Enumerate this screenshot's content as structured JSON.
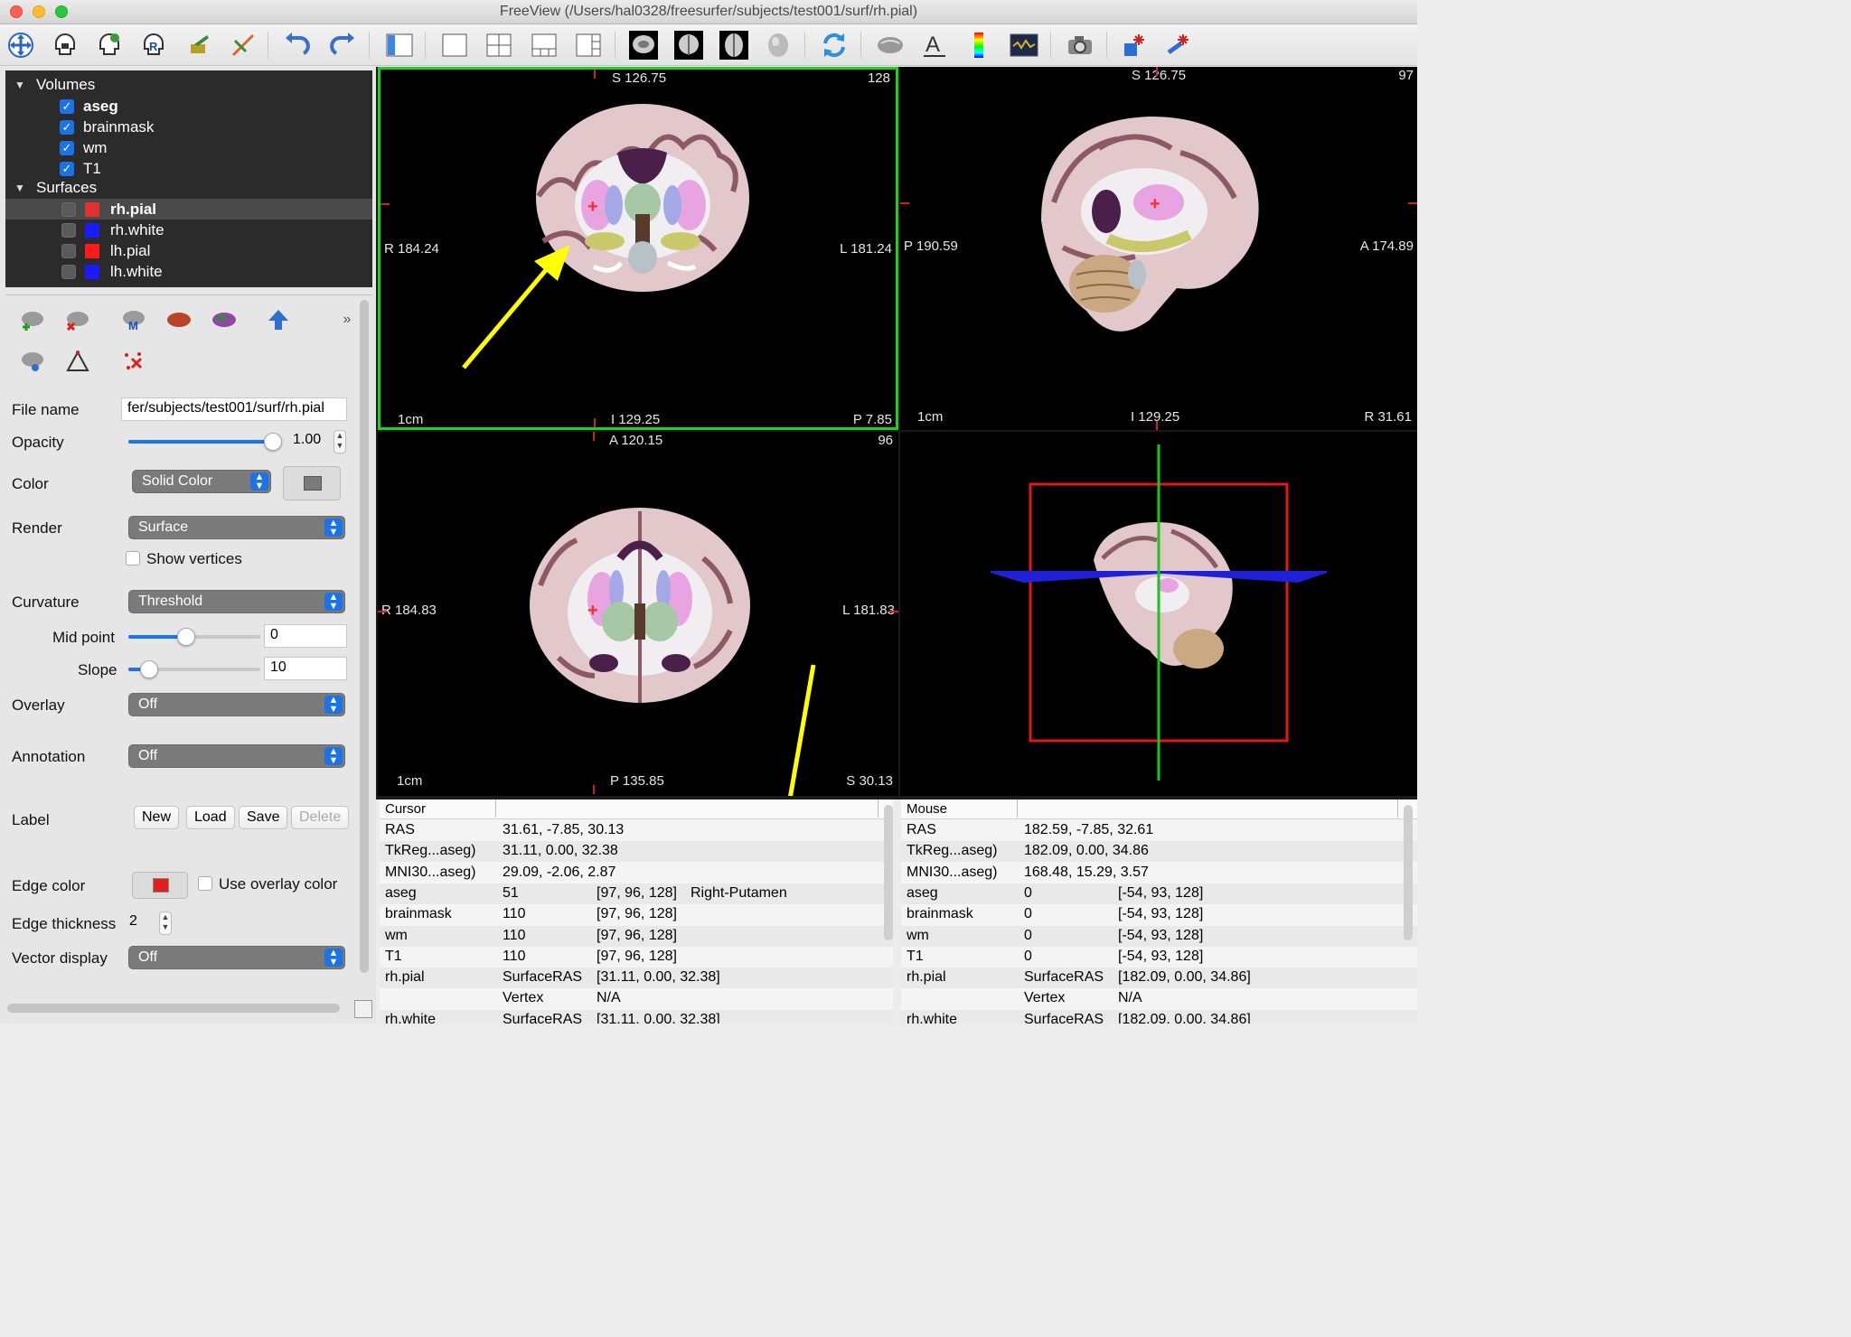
{
  "window": {
    "title": "FreeView (/Users/hal0328/freesurfer/subjects/test001/surf/rh.pial)"
  },
  "toolbar": {
    "icons": [
      "navigate-icon",
      "voxel-edit-icon",
      "recon-edit-icon",
      "roi-edit-icon",
      "point-set-edit-icon",
      "contour-icon",
      "undo-icon",
      "redo-icon",
      "toggle-panel-icon",
      "layout-1x1-icon",
      "layout-2x2-icon",
      "layout-1and3-icon",
      "layout-1and3-horizontal-icon",
      "view-sagittal-icon",
      "view-coronal-icon",
      "view-axial-icon",
      "view-3d-icon",
      "reset-view-icon",
      "show-slices-icon",
      "show-text-icon",
      "colorbar-icon",
      "command-console-icon",
      "screenshot-icon",
      "transform-volume-icon",
      "reposition-surface-icon"
    ]
  },
  "layers": {
    "groups": [
      {
        "label": "Volumes",
        "items": [
          {
            "name": "aseg",
            "checked": true,
            "bold": true
          },
          {
            "name": "brainmask",
            "checked": true
          },
          {
            "name": "wm",
            "checked": true
          },
          {
            "name": "T1",
            "checked": true
          }
        ]
      },
      {
        "label": "Surfaces",
        "items": [
          {
            "name": "rh.pial",
            "checked": false,
            "color": "#e03030",
            "selected": true
          },
          {
            "name": "rh.white",
            "checked": false,
            "color": "#1a1aff"
          },
          {
            "name": "lh.pial",
            "checked": false,
            "color": "#ff1a1a"
          },
          {
            "name": "lh.white",
            "checked": false,
            "color": "#1a1aff"
          }
        ]
      }
    ]
  },
  "props": {
    "file_name_label": "File name",
    "file_name_value": "fer/subjects/test001/surf/rh.pial",
    "opacity_label": "Opacity",
    "opacity_value": "1.00",
    "opacity_fraction": 1.0,
    "color_label": "Color",
    "color_mode": "Solid Color",
    "render_label": "Render",
    "render_value": "Surface",
    "show_vertices_label": "Show vertices",
    "curvature_label": "Curvature",
    "curvature_value": "Threshold",
    "midpoint_label": "Mid point",
    "midpoint_value": "0",
    "slope_label": "Slope",
    "slope_value": "10",
    "overlay_label": "Overlay",
    "overlay_value": "Off",
    "annotation_label": "Annotation",
    "annotation_value": "Off",
    "label_label": "Label",
    "label_buttons": [
      "New",
      "Load",
      "Save",
      "Delete"
    ],
    "edge_color_label": "Edge color",
    "edge_color": "#e02020",
    "use_overlay_color_label": "Use overlay color",
    "edge_thickness_label": "Edge thickness",
    "edge_thickness_value": "2",
    "vector_display_label": "Vector display",
    "vector_display_value": "Off"
  },
  "views": {
    "coronal": {
      "top": "S 126.75",
      "slice": "128",
      "left": "R 184.24",
      "right": "L 181.24",
      "bottom": "I 129.25",
      "bottom_right": "P 7.85",
      "scale": "1cm"
    },
    "sagittal": {
      "top": "S 126.75",
      "slice": "97",
      "left": "P 190.59",
      "right": "A 174.89",
      "bottom": "I 129.25",
      "bottom_right": "R 31.61",
      "scale": "1cm"
    },
    "axial": {
      "top": "A 120.15",
      "slice": "96",
      "left": "R 184.83",
      "right": "L 181.83",
      "bottom": "P 135.85",
      "bottom_right": "S 30.13",
      "scale": "1cm"
    }
  },
  "cursor_info": {
    "header": "Cursor",
    "rows": [
      [
        "RAS",
        "31.61, -7.85, 30.13",
        "",
        ""
      ],
      [
        "TkReg...aseg)",
        "31.11, 0.00, 32.38",
        "",
        ""
      ],
      [
        "MNI30...aseg)",
        "29.09, -2.06, 2.87",
        "",
        ""
      ],
      [
        "aseg",
        "51",
        "[97, 96, 128]",
        "Right-Putamen"
      ],
      [
        "brainmask",
        "110",
        "[97, 96, 128]",
        ""
      ],
      [
        "wm",
        "110",
        "[97, 96, 128]",
        ""
      ],
      [
        "T1",
        "110",
        "[97, 96, 128]",
        ""
      ],
      [
        "rh.pial",
        "SurfaceRAS",
        "[31.11, 0.00, 32.38]",
        ""
      ],
      [
        "",
        "Vertex",
        "N/A",
        ""
      ],
      [
        "rh.white",
        "SurfaceRAS",
        "[31.11, 0.00, 32.38]",
        ""
      ]
    ]
  },
  "mouse_info": {
    "header": "Mouse",
    "rows": [
      [
        "RAS",
        "182.59, -7.85, 32.61",
        "",
        ""
      ],
      [
        "TkReg...aseg)",
        "182.09, 0.00, 34.86",
        "",
        ""
      ],
      [
        "MNI30...aseg)",
        "168.48, 15.29, 3.57",
        "",
        ""
      ],
      [
        "aseg",
        "0",
        "[-54, 93, 128]",
        ""
      ],
      [
        "brainmask",
        "0",
        "[-54, 93, 128]",
        ""
      ],
      [
        "wm",
        "0",
        "[-54, 93, 128]",
        ""
      ],
      [
        "T1",
        "0",
        "[-54, 93, 128]",
        ""
      ],
      [
        "rh.pial",
        "SurfaceRAS",
        "[182.09, 0.00, 34.86]",
        ""
      ],
      [
        "",
        "Vertex",
        "N/A",
        ""
      ],
      [
        "rh.white",
        "SurfaceRAS",
        "[182.09, 0.00, 34.86]",
        ""
      ]
    ]
  }
}
